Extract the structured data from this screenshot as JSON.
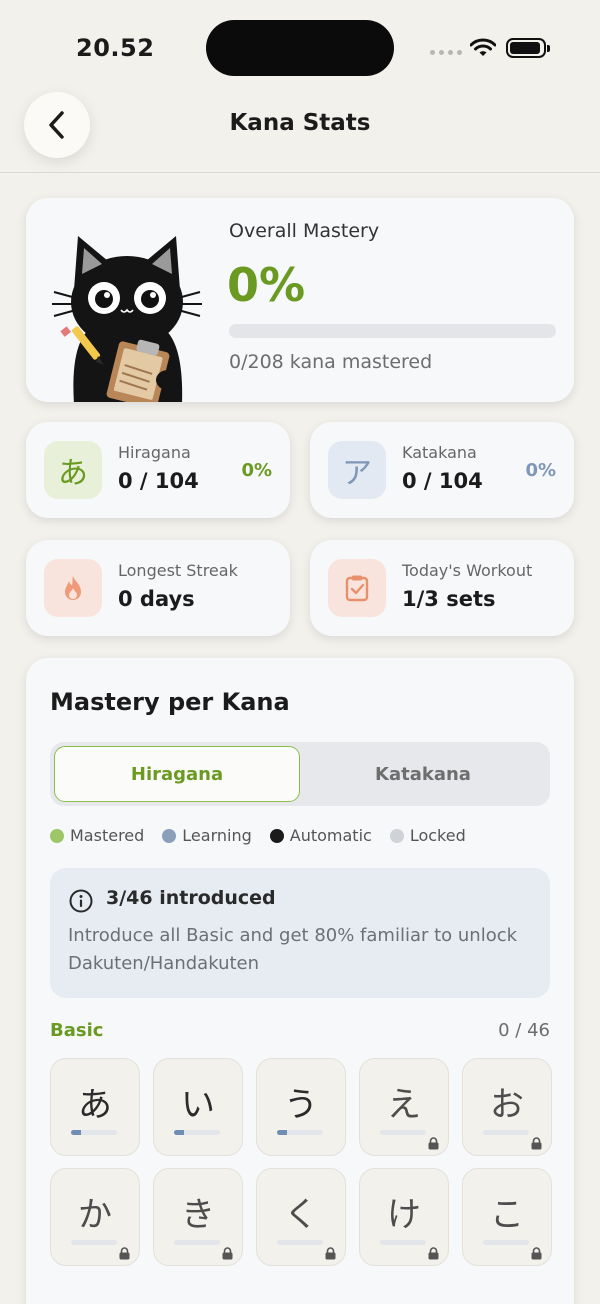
{
  "status": {
    "time": "20.52"
  },
  "header": {
    "title": "Kana Stats"
  },
  "overall": {
    "label": "Overall Mastery",
    "percent": "0%",
    "progress": 0,
    "sub": "0/208 kana mastered"
  },
  "stats": {
    "hiragana": {
      "glyph": "あ",
      "label": "Hiragana",
      "value": "0 / 104",
      "percent": "0%"
    },
    "katakana": {
      "glyph": "ア",
      "label": "Katakana",
      "value": "0 / 104",
      "percent": "0%"
    },
    "streak": {
      "icon": "flame-icon",
      "label": "Longest Streak",
      "value": "0 days"
    },
    "workout": {
      "icon": "clipboard-check-icon",
      "label": "Today's Workout",
      "value": "1/3 sets"
    }
  },
  "mastery": {
    "title": "Mastery per Kana",
    "tabs": [
      {
        "label": "Hiragana",
        "active": true
      },
      {
        "label": "Katakana",
        "active": false
      }
    ],
    "legend": [
      {
        "label": "Mastered",
        "color": "#9cc767"
      },
      {
        "label": "Learning",
        "color": "#8ba0b8"
      },
      {
        "label": "Automatic",
        "color": "#1b1b1b"
      },
      {
        "label": "Locked",
        "color": "#cfd2d7"
      }
    ],
    "info": {
      "title": "3/46 introduced",
      "body": "Introduce all Basic and get 80% familiar to unlock Dakuten/Handakuten"
    },
    "section": {
      "label": "Basic",
      "count": "0 / 46"
    },
    "tiles": [
      {
        "kana": "あ",
        "progress": 0.22,
        "locked": false
      },
      {
        "kana": "い",
        "progress": 0.22,
        "locked": false
      },
      {
        "kana": "う",
        "progress": 0.22,
        "locked": false
      },
      {
        "kana": "え",
        "progress": 0,
        "locked": true
      },
      {
        "kana": "お",
        "progress": 0,
        "locked": true
      },
      {
        "kana": "か",
        "progress": 0,
        "locked": true
      },
      {
        "kana": "き",
        "progress": 0,
        "locked": true
      },
      {
        "kana": "く",
        "progress": 0,
        "locked": true
      },
      {
        "kana": "け",
        "progress": 0,
        "locked": true
      },
      {
        "kana": "こ",
        "progress": 0,
        "locked": true
      }
    ]
  },
  "colors": {
    "accent": "#6a9a22",
    "katakana": "#7f97b8",
    "background": "#f3f1ec"
  }
}
